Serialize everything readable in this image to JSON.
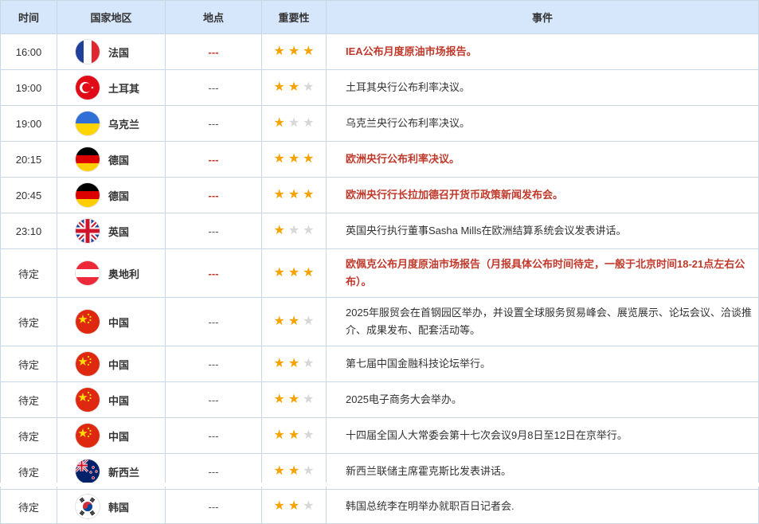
{
  "headers": {
    "time": "时间",
    "country": "国家地区",
    "location": "地点",
    "importance": "重要性",
    "event": "事件"
  },
  "colors": {
    "accent_red": "#c0392b",
    "star_on": "#f5a300",
    "star_off": "#d7d7d7",
    "header_bg": "#d6e6fb"
  },
  "rows": [
    {
      "time": "16:00",
      "country": "法国",
      "flag": "france-flag-icon",
      "location": "---",
      "stars": 3,
      "event": "IEA公布月度原油市场报告。",
      "highlight": true
    },
    {
      "time": "19:00",
      "country": "土耳其",
      "flag": "turkey-flag-icon",
      "location": "---",
      "stars": 2,
      "event": "土耳其央行公布利率决议。",
      "highlight": false
    },
    {
      "time": "19:00",
      "country": "乌克兰",
      "flag": "ukraine-flag-icon",
      "location": "---",
      "stars": 1,
      "event": "乌克兰央行公布利率决议。",
      "highlight": false
    },
    {
      "time": "20:15",
      "country": "德国",
      "flag": "germany-flag-icon",
      "location": "---",
      "stars": 3,
      "event": "欧洲央行公布利率决议。",
      "highlight": true
    },
    {
      "time": "20:45",
      "country": "德国",
      "flag": "germany-flag-icon",
      "location": "---",
      "stars": 3,
      "event": "欧洲央行行长拉加德召开货币政策新闻发布会。",
      "highlight": true
    },
    {
      "time": "23:10",
      "country": "英国",
      "flag": "uk-flag-icon",
      "location": "---",
      "stars": 1,
      "event": "英国央行执行董事Sasha Mills在欧洲结算系统会议发表讲话。",
      "highlight": false
    },
    {
      "time": "待定",
      "country": "奥地利",
      "flag": "austria-flag-icon",
      "location": "---",
      "stars": 3,
      "event": "欧佩克公布月度原油市场报告（月报具体公布时间待定，一般于北京时间18-21点左右公布）。",
      "highlight": true
    },
    {
      "time": "待定",
      "country": "中国",
      "flag": "china-flag-icon",
      "location": "---",
      "stars": 2,
      "event": "2025年服贸会在首钢园区举办，并设置全球服务贸易峰会、展览展示、论坛会议、洽谈推介、成果发布、配套活动等。",
      "highlight": false
    },
    {
      "time": "待定",
      "country": "中国",
      "flag": "china-flag-icon",
      "location": "---",
      "stars": 2,
      "event": "第七届中国金融科技论坛举行。",
      "highlight": false
    },
    {
      "time": "待定",
      "country": "中国",
      "flag": "china-flag-icon",
      "location": "---",
      "stars": 2,
      "event": "2025电子商务大会举办。",
      "highlight": false
    },
    {
      "time": "待定",
      "country": "中国",
      "flag": "china-flag-icon",
      "location": "---",
      "stars": 2,
      "event": "十四届全国人大常委会第十七次会议9月8日至12日在京举行。",
      "highlight": false
    },
    {
      "time": "待定",
      "country": "新西兰",
      "flag": "new-zealand-flag-icon",
      "location": "---",
      "stars": 2,
      "event": "新西兰联储主席霍克斯比发表讲话。",
      "highlight": false
    },
    {
      "time": "待定",
      "country": "韩国",
      "flag": "south-korea-flag-icon",
      "location": "---",
      "stars": 2,
      "event": "韩国总统李在明举办就职百日记者会.",
      "highlight": false
    }
  ]
}
